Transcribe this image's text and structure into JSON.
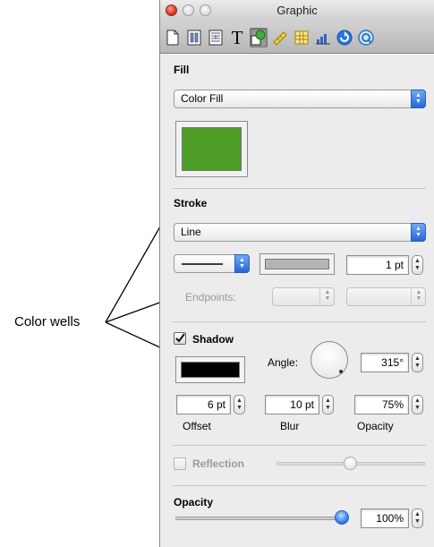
{
  "window": {
    "title": "Graphic"
  },
  "toolbar": {
    "items": [
      {
        "icon": "document-icon"
      },
      {
        "icon": "layout-icon"
      },
      {
        "icon": "wrap-icon"
      },
      {
        "icon": "text-icon",
        "glyph": "T"
      },
      {
        "icon": "graphic-icon",
        "selected": true
      },
      {
        "icon": "metrics-icon"
      },
      {
        "icon": "table-icon"
      },
      {
        "icon": "chart-icon"
      },
      {
        "icon": "link-icon"
      },
      {
        "icon": "quicktime-icon"
      }
    ]
  },
  "fill": {
    "heading": "Fill",
    "type": "Color Fill",
    "color": "#4e9d27"
  },
  "stroke": {
    "heading": "Stroke",
    "type": "Line",
    "color": "#b5b5b5",
    "width": "1 pt",
    "endpoints_label": "Endpoints:"
  },
  "shadow": {
    "heading": "Shadow",
    "enabled": true,
    "color": "#000000",
    "angle_label": "Angle:",
    "angle": "315°",
    "offset": "6 pt",
    "offset_label": "Offset",
    "blur": "10 pt",
    "blur_label": "Blur",
    "opacity": "75%",
    "opacity_label": "Opacity"
  },
  "reflection": {
    "label": "Reflection",
    "enabled": false
  },
  "opacity": {
    "heading": "Opacity",
    "value": "100%",
    "level": 1.0
  },
  "callout": {
    "label": "Color wells"
  },
  "colors": {
    "accent": "#2767d9"
  }
}
